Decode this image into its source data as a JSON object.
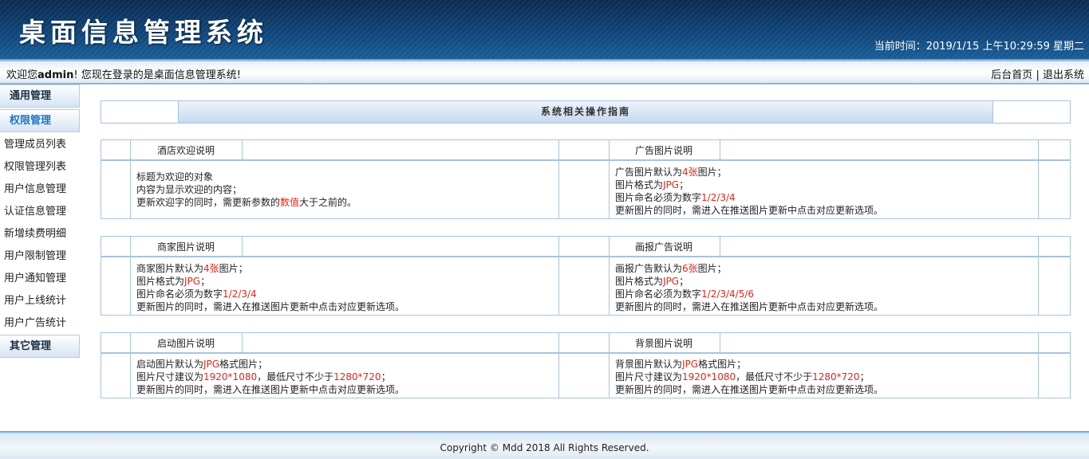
{
  "header": {
    "title": "桌面信息管理系统",
    "clock": "当前时间：2019/1/15 上午10:29:59 星期二"
  },
  "welcome": {
    "prefix": "欢迎您",
    "user": "admin",
    "suffix": "! 您现在登录的是桌面信息管理系统!",
    "home_link": "后台首页",
    "sep": "|",
    "logout_link": "退出系统"
  },
  "sidebar": {
    "group1": "通用管理",
    "group2": "权限管理",
    "items": [
      "管理成员列表",
      "权限管理列表",
      "用户信息管理",
      "认证信息管理",
      "新增续费明细",
      "用户限制管理",
      "用户通知管理",
      "用户上线统计",
      "用户广告统计"
    ],
    "group3": "其它管理"
  },
  "guide": {
    "title": "系统相关操作指南"
  },
  "blocks": [
    {
      "left": {
        "title": "酒店欢迎说明",
        "lines": [
          [
            {
              "t": "标题为欢迎的对象"
            }
          ],
          [
            {
              "t": "内容为显示欢迎的内容；"
            }
          ],
          [
            {
              "t": "更新欢迎字的同时，需更新参数的"
            },
            {
              "t": "数值",
              "red": true
            },
            {
              "t": "大于之前的。"
            }
          ]
        ]
      },
      "right": {
        "title": "广告图片说明",
        "lines": [
          [
            {
              "t": "广告图片默认为"
            },
            {
              "t": "4张",
              "red": true
            },
            {
              "t": "图片；"
            }
          ],
          [
            {
              "t": "图片格式为"
            },
            {
              "t": "JPG",
              "red": true
            },
            {
              "t": "；"
            }
          ],
          [
            {
              "t": "图片命名必须为数字"
            },
            {
              "t": "1/2/3/4",
              "red": true
            }
          ],
          [
            {
              "t": "更新图片的同时，需进入在推送图片更新中点击对应更新选项。"
            }
          ]
        ]
      }
    },
    {
      "left": {
        "title": "商家图片说明",
        "lines": [
          [
            {
              "t": "商家图片默认为"
            },
            {
              "t": "4张",
              "red": true
            },
            {
              "t": "图片；"
            }
          ],
          [
            {
              "t": "图片格式为"
            },
            {
              "t": "JPG",
              "red": true
            },
            {
              "t": "；"
            }
          ],
          [
            {
              "t": "图片命名必须为数字"
            },
            {
              "t": "1/2/3/4",
              "red": true
            }
          ],
          [
            {
              "t": "更新图片的同时，需进入在推送图片更新中点击对应更新选项。"
            }
          ]
        ]
      },
      "right": {
        "title": "画报广告说明",
        "lines": [
          [
            {
              "t": "画报广告默认为"
            },
            {
              "t": "6张",
              "red": true
            },
            {
              "t": "图片；"
            }
          ],
          [
            {
              "t": "图片格式为"
            },
            {
              "t": "JPG",
              "red": true
            },
            {
              "t": "；"
            }
          ],
          [
            {
              "t": "图片命名必须为数字"
            },
            {
              "t": "1/2/3/4/5/6",
              "red": true
            }
          ],
          [
            {
              "t": "更新图片的同时，需进入在推送图片更新中点击对应更新选项。"
            }
          ]
        ]
      }
    },
    {
      "left": {
        "title": "启动图片说明",
        "lines": [
          [
            {
              "t": "启动图片默认为"
            },
            {
              "t": "JPG",
              "red": true
            },
            {
              "t": "格式图片；"
            }
          ],
          [
            {
              "t": "图片尺寸建议为"
            },
            {
              "t": "1920*1080",
              "red": true
            },
            {
              "t": "，最低尺寸不少于"
            },
            {
              "t": "1280*720",
              "red": true
            },
            {
              "t": "；"
            }
          ],
          [
            {
              "t": "更新图片的同时，需进入在推送图片更新中点击对应更新选项。"
            }
          ]
        ]
      },
      "right": {
        "title": "背景图片说明",
        "lines": [
          [
            {
              "t": "背景图片默认为"
            },
            {
              "t": "JPG",
              "red": true
            },
            {
              "t": "格式图片；"
            }
          ],
          [
            {
              "t": "图片尺寸建议为"
            },
            {
              "t": "1920*1080",
              "red": true
            },
            {
              "t": "，最低尺寸不少于"
            },
            {
              "t": "1280*720",
              "red": true
            },
            {
              "t": "；"
            }
          ],
          [
            {
              "t": "更新图片的同时，需进入在推送图片更新中点击对应更新选项。"
            }
          ]
        ]
      }
    }
  ],
  "footer": {
    "copyright": "Copyright © Mdd 2018 All Rights Reserved."
  }
}
